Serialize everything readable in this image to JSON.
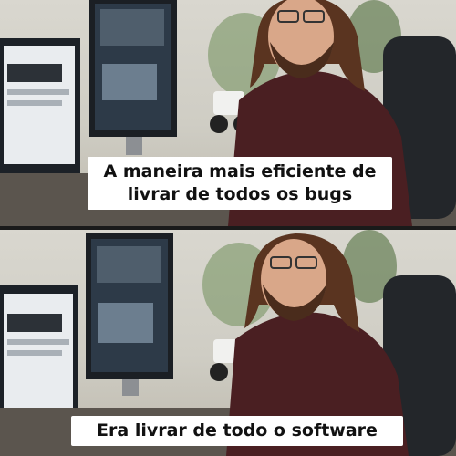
{
  "meme": {
    "top_caption": "A maneira mais eficiente de\nlivrar de todos os bugs",
    "bottom_caption": "Era livrar de todo o software"
  },
  "colors": {
    "wall": "#d3d0c7",
    "shirt": "#4a1f22",
    "hair": "#5a3420",
    "monitor": "#1b1f24",
    "caption_bg": "#ffffff",
    "caption_text": "#111111"
  }
}
